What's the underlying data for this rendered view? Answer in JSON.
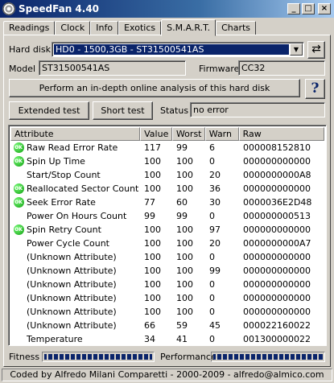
{
  "window": {
    "title": "SpeedFan 4.40"
  },
  "titlebar_buttons": {
    "minimize": "_",
    "maximize": "□",
    "close": "×"
  },
  "tabs": [
    {
      "label": "Readings"
    },
    {
      "label": "Clock"
    },
    {
      "label": "Info"
    },
    {
      "label": "Exotics"
    },
    {
      "label": "S.M.A.R.T."
    },
    {
      "label": "Charts"
    }
  ],
  "active_tab": "S.M.A.R.T.",
  "harddisk": {
    "label": "Hard disk",
    "selected": "HD0 - 1500,3GB - ST31500541AS",
    "refresh_icon": "refresh-icon"
  },
  "model": {
    "label": "Model",
    "value": "ST31500541AS"
  },
  "firmware": {
    "label": "Firmware",
    "value": "CC32"
  },
  "analysis_button": "Perform an in-depth online analysis of this hard disk",
  "help_button": "?",
  "extended_test_button": "Extended test",
  "short_test_button": "Short test",
  "status": {
    "label": "Status",
    "value": "no error"
  },
  "table": {
    "columns": [
      "Attribute",
      "Value",
      "Worst",
      "Warn",
      "Raw"
    ],
    "rows": [
      {
        "ok": true,
        "attribute": "Raw Read Error Rate",
        "value": "117",
        "worst": "99",
        "warn": "6",
        "raw": "000008152810"
      },
      {
        "ok": true,
        "attribute": "Spin Up Time",
        "value": "100",
        "worst": "100",
        "warn": "0",
        "raw": "000000000000"
      },
      {
        "ok": false,
        "attribute": "Start/Stop Count",
        "value": "100",
        "worst": "100",
        "warn": "20",
        "raw": "0000000000A8"
      },
      {
        "ok": true,
        "attribute": "Reallocated Sector Count",
        "value": "100",
        "worst": "100",
        "warn": "36",
        "raw": "000000000000"
      },
      {
        "ok": true,
        "attribute": "Seek Error Rate",
        "value": "77",
        "worst": "60",
        "warn": "30",
        "raw": "0000036E2D48"
      },
      {
        "ok": false,
        "attribute": "Power On Hours Count",
        "value": "99",
        "worst": "99",
        "warn": "0",
        "raw": "000000000513"
      },
      {
        "ok": true,
        "attribute": "Spin Retry Count",
        "value": "100",
        "worst": "100",
        "warn": "97",
        "raw": "000000000000"
      },
      {
        "ok": false,
        "attribute": "Power Cycle Count",
        "value": "100",
        "worst": "100",
        "warn": "20",
        "raw": "0000000000A7"
      },
      {
        "ok": false,
        "attribute": "(Unknown Attribute)",
        "value": "100",
        "worst": "100",
        "warn": "0",
        "raw": "000000000000"
      },
      {
        "ok": false,
        "attribute": "(Unknown Attribute)",
        "value": "100",
        "worst": "100",
        "warn": "99",
        "raw": "000000000000"
      },
      {
        "ok": false,
        "attribute": "(Unknown Attribute)",
        "value": "100",
        "worst": "100",
        "warn": "0",
        "raw": "000000000000"
      },
      {
        "ok": false,
        "attribute": "(Unknown Attribute)",
        "value": "100",
        "worst": "100",
        "warn": "0",
        "raw": "000000000000"
      },
      {
        "ok": false,
        "attribute": "(Unknown Attribute)",
        "value": "100",
        "worst": "100",
        "warn": "0",
        "raw": "000000000000"
      },
      {
        "ok": false,
        "attribute": "(Unknown Attribute)",
        "value": "66",
        "worst": "59",
        "warn": "45",
        "raw": "000022160022"
      },
      {
        "ok": false,
        "attribute": "Temperature",
        "value": "34",
        "worst": "41",
        "warn": "0",
        "raw": "001300000022"
      }
    ],
    "ok_icon_text": "OK"
  },
  "fitness": {
    "label": "Fitness"
  },
  "performance": {
    "label": "Performance"
  },
  "statusbar": "Coded by Alfredo Milani Comparetti - 2000-2009 - alfredo@almico.com",
  "colors": {
    "titlebar": "#0a246a",
    "selection": "#0a246a",
    "ok": "#0a9a0a",
    "face": "#d4d0c8"
  }
}
